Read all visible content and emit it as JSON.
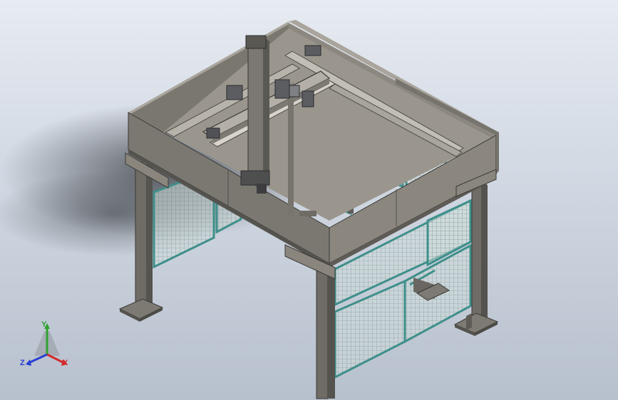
{
  "viewport": {
    "background_top": "#e7ebf2",
    "background_bottom": "#b7c0cd",
    "steel_color": "#6f6c66",
    "steel_light": "#8a867e",
    "steel_dark": "#4c4a46",
    "mesh_frame_color": "#3f8f8a",
    "mesh_fill_color": "#c9d9d6"
  },
  "triad": {
    "x_label": "X",
    "y_label": "Y",
    "z_label": "Z",
    "x_color": "#d22a2a",
    "y_color": "#2fa22f",
    "z_color": "#2a3fd2"
  }
}
